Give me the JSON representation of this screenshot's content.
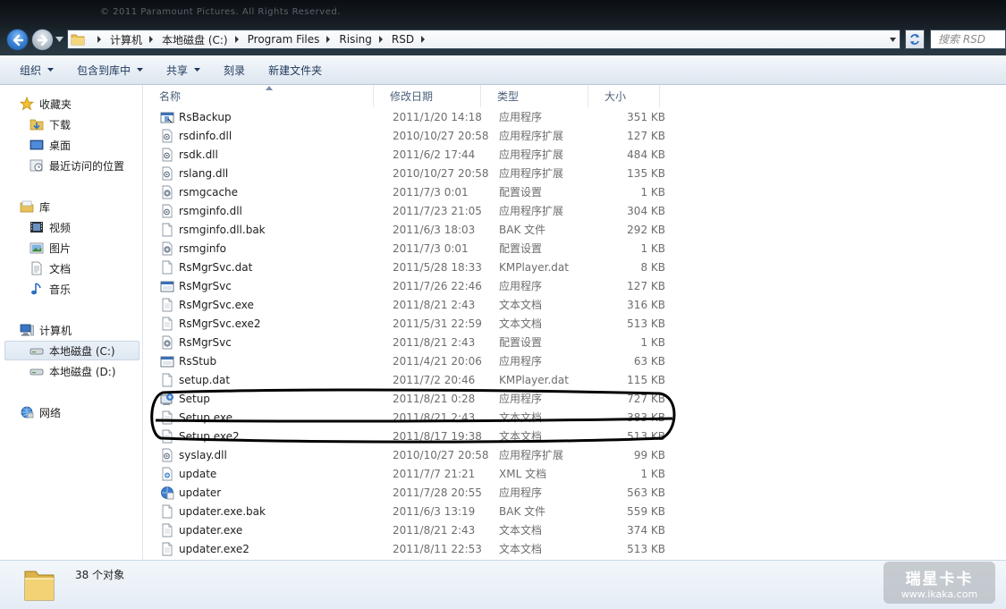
{
  "window": {
    "caption": "© 2011 Paramount Pictures. All Rights Reserved."
  },
  "address": {
    "breadcrumbs": [
      "计算机",
      "本地磁盘 (C:)",
      "Program Files",
      "Rising",
      "RSD"
    ]
  },
  "search": {
    "placeholder": "搜索 RSD"
  },
  "toolbar": {
    "organize": "组织",
    "include_library": "包含到库中",
    "share": "共享",
    "burn": "刻录",
    "new_folder": "新建文件夹"
  },
  "nav": {
    "favorites": "收藏夹",
    "downloads": "下载",
    "desktop": "桌面",
    "recent": "最近访问的位置",
    "libraries": "库",
    "videos": "视频",
    "pictures": "图片",
    "documents": "文档",
    "music": "音乐",
    "computer": "计算机",
    "drive_c": "本地磁盘 (C:)",
    "drive_d": "本地磁盘 (D:)",
    "network": "网络"
  },
  "columns": {
    "name": "名称",
    "date": "修改日期",
    "type": "类型",
    "size": "大小"
  },
  "files": [
    {
      "name": "RsBackup",
      "date": "2011/1/20 14:18",
      "type": "应用程序",
      "size": "351 KB",
      "icon": "exe-icon"
    },
    {
      "name": "rsdinfo.dll",
      "date": "2010/10/27 20:58",
      "type": "应用程序扩展",
      "size": "127 KB",
      "icon": "dll-icon"
    },
    {
      "name": "rsdk.dll",
      "date": "2011/6/2 17:44",
      "type": "应用程序扩展",
      "size": "484 KB",
      "icon": "dll-icon"
    },
    {
      "name": "rslang.dll",
      "date": "2010/10/27 20:58",
      "type": "应用程序扩展",
      "size": "135 KB",
      "icon": "dll-icon"
    },
    {
      "name": "rsmgcache",
      "date": "2011/7/3 0:01",
      "type": "配置设置",
      "size": "1 KB",
      "icon": "config-icon"
    },
    {
      "name": "rsmginfo.dll",
      "date": "2011/7/23 21:05",
      "type": "应用程序扩展",
      "size": "304 KB",
      "icon": "dll-icon"
    },
    {
      "name": "rsmginfo.dll.bak",
      "date": "2011/6/3 18:03",
      "type": "BAK 文件",
      "size": "292 KB",
      "icon": "file-icon"
    },
    {
      "name": "rsmginfo",
      "date": "2011/7/3 0:01",
      "type": "配置设置",
      "size": "1 KB",
      "icon": "config-icon"
    },
    {
      "name": "RsMgrSvc.dat",
      "date": "2011/5/28 18:33",
      "type": "KMPlayer.dat",
      "size": "8 KB",
      "icon": "file-icon"
    },
    {
      "name": "RsMgrSvc",
      "date": "2011/7/26 22:46",
      "type": "应用程序",
      "size": "127 KB",
      "icon": "window-exe-icon"
    },
    {
      "name": "RsMgrSvc.exe",
      "date": "2011/8/21 2:43",
      "type": "文本文档",
      "size": "316 KB",
      "icon": "text-icon"
    },
    {
      "name": "RsMgrSvc.exe2",
      "date": "2011/5/31 22:59",
      "type": "文本文档",
      "size": "513 KB",
      "icon": "text-icon"
    },
    {
      "name": "RsMgrSvc",
      "date": "2011/8/21 2:43",
      "type": "配置设置",
      "size": "1 KB",
      "icon": "config-icon"
    },
    {
      "name": "RsStub",
      "date": "2011/4/21 20:06",
      "type": "应用程序",
      "size": "63 KB",
      "icon": "window-exe-icon"
    },
    {
      "name": "setup.dat",
      "date": "2011/7/2 20:46",
      "type": "KMPlayer.dat",
      "size": "115 KB",
      "icon": "file-icon"
    },
    {
      "name": "Setup",
      "date": "2011/8/21 0:28",
      "type": "应用程序",
      "size": "727 KB",
      "icon": "setup-icon"
    },
    {
      "name": "Setup.exe",
      "date": "2011/8/21 2:43",
      "type": "文本文档",
      "size": "383 KB",
      "icon": "text-icon"
    },
    {
      "name": "Setup.exe2",
      "date": "2011/8/17 19:38",
      "type": "文本文档",
      "size": "513 KB",
      "icon": "text-icon"
    },
    {
      "name": "syslay.dll",
      "date": "2010/10/27 20:58",
      "type": "应用程序扩展",
      "size": "99 KB",
      "icon": "dll-icon"
    },
    {
      "name": "update",
      "date": "2011/7/7 21:21",
      "type": "XML 文档",
      "size": "1 KB",
      "icon": "xml-icon"
    },
    {
      "name": "updater",
      "date": "2011/7/28 20:55",
      "type": "应用程序",
      "size": "563 KB",
      "icon": "updater-icon"
    },
    {
      "name": "updater.exe.bak",
      "date": "2011/6/3 13:19",
      "type": "BAK 文件",
      "size": "559 KB",
      "icon": "file-icon"
    },
    {
      "name": "updater.exe",
      "date": "2011/8/21 2:43",
      "type": "文本文档",
      "size": "374 KB",
      "icon": "text-icon"
    },
    {
      "name": "updater.exe2",
      "date": "2011/8/11 22:53",
      "type": "文本文档",
      "size": "513 KB",
      "icon": "text-icon"
    }
  ],
  "details": {
    "count": "38 个对象"
  },
  "watermark": {
    "line1": "瑞星卡卡",
    "line2": "www.ikaka.com"
  }
}
